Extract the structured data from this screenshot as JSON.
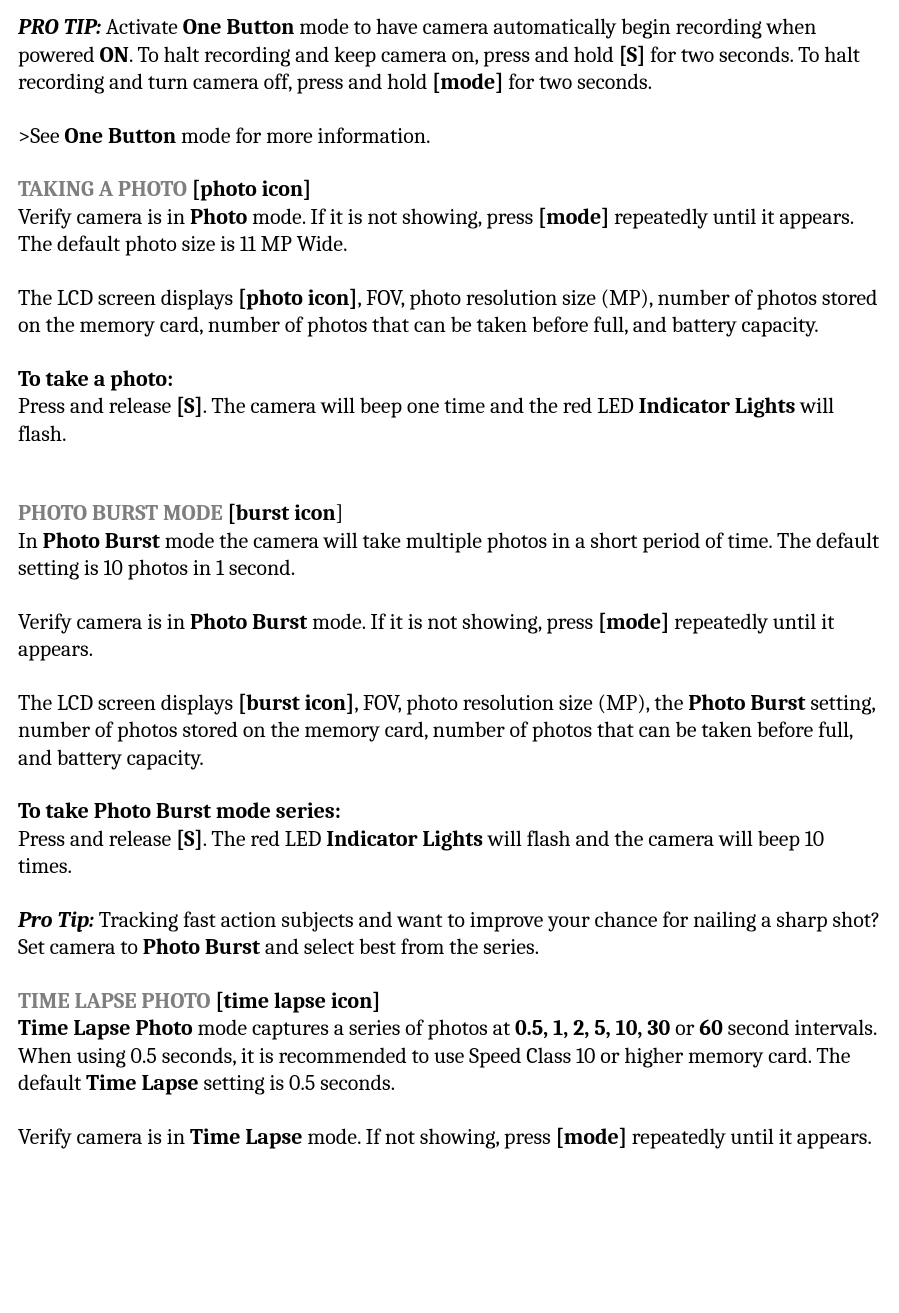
{
  "protip1": {
    "label": "PRO TIP:",
    "t1": " Activate ",
    "b1": "One Button",
    "t2": " mode to have camera automatically begin recording when powered ",
    "b2": "ON",
    "t3": ". To halt recording and keep camera on, press and hold ",
    "b3": "[S]",
    "t4": " for two seconds. To halt recording and turn camera off, press and hold ",
    "b4": "[mode]",
    "t5": " for two seconds."
  },
  "see": {
    "t1": ">See ",
    "b1": "One Button",
    "t2": " mode for more information."
  },
  "photo": {
    "head": "TAKING A PHOTO ",
    "icon": "[photo icon]",
    "p1_t1": "Verify camera is in ",
    "p1_b1": "Photo",
    "p1_t2": " mode. If it is not showing, press ",
    "p1_b2": "[mode]",
    "p1_t3": " repeatedly until it appears. The default photo size is 11 MP Wide.",
    "p2_t1": "The LCD screen displays ",
    "p2_b1": "[photo icon]",
    "p2_t2": ", FOV, photo resolution size (MP), number of photos stored on the memory card, number of photos that can be taken before full, and battery capacity.",
    "p3_head": "To take a photo:",
    "p3_t1": "Press and release ",
    "p3_b1": "[S]",
    "p3_t2": ". The camera will beep one time and the red LED ",
    "p3_b2": "Indicator Lights",
    "p3_t3": " will flash."
  },
  "burst": {
    "head": "PHOTO BURST MODE ",
    "icon": "[burst icon",
    "icon_close": "]",
    "p1_t1": "In ",
    "p1_b1": "Photo Burst",
    "p1_t2": " mode the camera will take multiple photos in a short period of time. The default setting is 10 photos in 1 second.",
    "p2_t1": "Verify camera is in ",
    "p2_b1": "Photo Burst",
    "p2_t2": " mode. If it is not showing, press ",
    "p2_b2": "[mode]",
    "p2_t3": " repeatedly until it appears.",
    "p3_t1": "The LCD screen displays ",
    "p3_b1": "[burst icon]",
    "p3_t2": ", FOV, photo resolution size (MP), the ",
    "p3_b2": "Photo Burst",
    "p3_t3": " setting, number of photos stored on the memory card, number of photos that can be taken before full, and battery capacity.",
    "p4_head": "To take Photo Burst mode series:",
    "p4_t1": "Press and release ",
    "p4_b1": "[S]",
    "p4_t2": ". The red LED ",
    "p4_b2": "Indicator Lights",
    "p4_t3": " will flash and the camera will beep 10 times.",
    "tip_label": "Pro Tip:",
    "tip_t1": " Tracking fast action subjects and want to improve your chance for nailing a sharp shot? Set camera to ",
    "tip_b1": "Photo Burst",
    "tip_t2": " and select best from the series."
  },
  "timelapse": {
    "head": "TIME LAPSE PHOTO ",
    "icon": "[time lapse icon]",
    "p1_b1": "Time Lapse Photo",
    "p1_t1": " mode captures a series of photos at ",
    "p1_b2": "0.5, 1, 2, 5, 10, 30",
    "p1_t2": " or ",
    "p1_b3": "60",
    "p1_t3": " second intervals. When using 0.5 seconds, it is recommended to use Speed Class 10 or higher memory card. The default ",
    "p1_b4": "Time Lapse",
    "p1_t4": " setting is 0.5 seconds.",
    "p2_t1": "Verify camera is in ",
    "p2_b1": "Time Lapse",
    "p2_t2": " mode. If not showing, press ",
    "p2_b2": "[mode]",
    "p2_t3": " repeatedly until it appears."
  }
}
